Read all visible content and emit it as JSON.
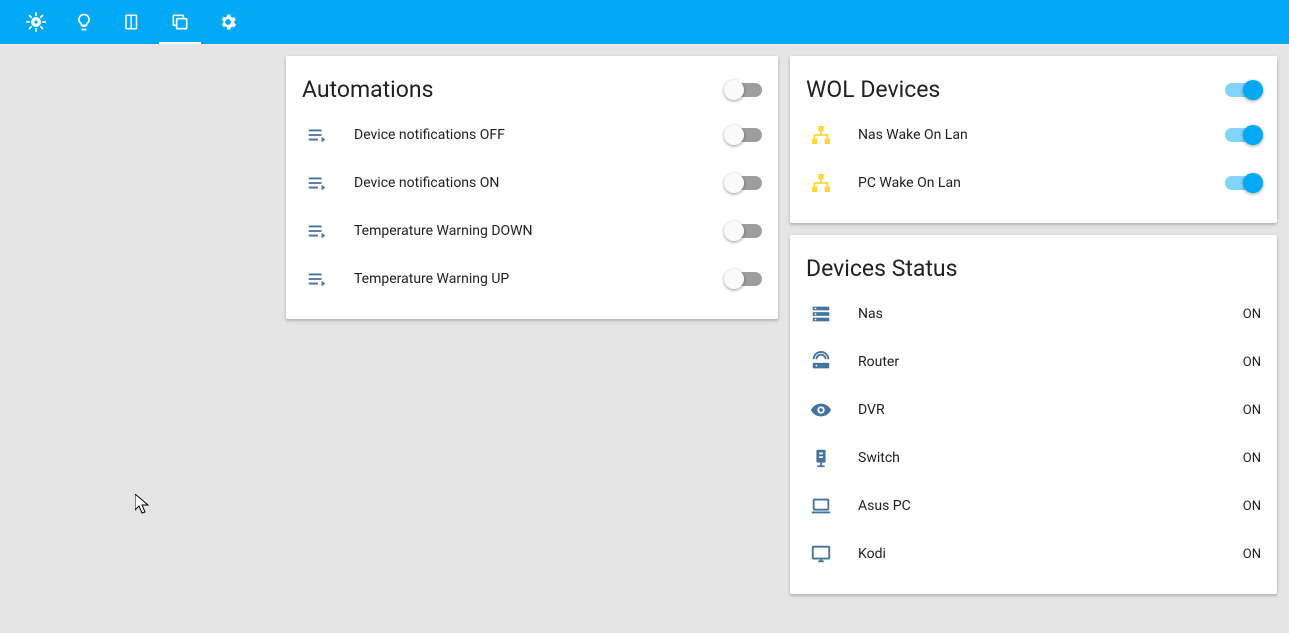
{
  "automations": {
    "title": "Automations",
    "header_toggle": false,
    "items": [
      {
        "label": "Device notifications OFF",
        "on": false
      },
      {
        "label": "Device notifications ON",
        "on": false
      },
      {
        "label": "Temperature Warning DOWN",
        "on": false
      },
      {
        "label": "Temperature Warning UP",
        "on": false
      }
    ]
  },
  "wol": {
    "title": "WOL Devices",
    "header_toggle": true,
    "items": [
      {
        "label": "Nas Wake On Lan",
        "on": true
      },
      {
        "label": "PC Wake On Lan",
        "on": true
      }
    ]
  },
  "devices": {
    "title": "Devices Status",
    "items": [
      {
        "label": "Nas",
        "status": "ON",
        "icon": "server"
      },
      {
        "label": "Router",
        "status": "ON",
        "icon": "router"
      },
      {
        "label": "DVR",
        "status": "ON",
        "icon": "eye"
      },
      {
        "label": "Switch",
        "status": "ON",
        "icon": "switch"
      },
      {
        "label": "Asus PC",
        "status": "ON",
        "icon": "laptop"
      },
      {
        "label": "Kodi",
        "status": "ON",
        "icon": "monitor"
      }
    ]
  }
}
